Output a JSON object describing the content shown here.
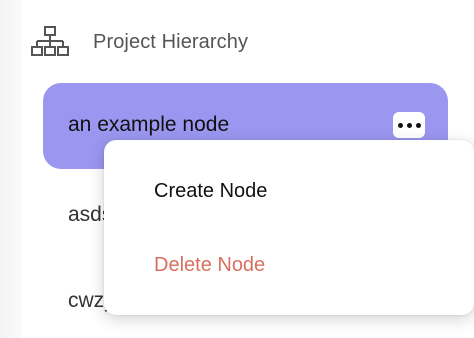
{
  "header": {
    "icon": "hierarchy-icon",
    "title": "Project Hierarchy"
  },
  "nodes": [
    {
      "label": "an example node",
      "selected": true
    },
    {
      "label": "asds"
    },
    {
      "label": "cwzy"
    }
  ],
  "context_menu": {
    "create_label": "Create Node",
    "delete_label": "Delete Node"
  },
  "colors": {
    "selected_bg": "#9b97f0",
    "delete_text": "#d9705f"
  }
}
